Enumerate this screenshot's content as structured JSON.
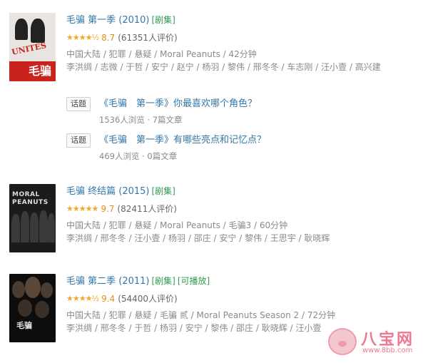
{
  "items": [
    {
      "title": "毛骗 第一季 (2010)",
      "tags": [
        "[剧集]"
      ],
      "stars": "★★★★½",
      "score": "8.7",
      "count": "(61351人评价)",
      "meta1": "中国大陆 / 犯罪 / 悬疑 / Moral Peanuts / 42分钟",
      "meta2": "李洪绸 / 志微 / 于哲 / 安宁 / 赵宁 / 杨羽 / 黎伟 / 邢冬冬 / 车志刚 / 汪小壹 / 高兴建",
      "poster_logo": "毛骗",
      "poster_text": "UNITES"
    },
    {
      "title": "毛骗 终结篇 (2015)",
      "tags": [
        "[剧集]"
      ],
      "stars": "★★★★★",
      "score": "9.7",
      "count": "(82411人评价)",
      "meta1": "中国大陆 / 犯罪 / 悬疑 / Moral Peanuts / 毛骗3 / 60分钟",
      "meta2": "李洪绸 / 邢冬冬 / 汪小壹 / 杨羽 / 邵庄 / 安宁 / 黎伟 / 王思宇 / 耿晓辉",
      "poster_line1": "MORAL",
      "poster_line2": "PEANUTS"
    },
    {
      "title": "毛骗 第二季 (2011)",
      "tags": [
        "[剧集]",
        "[可播放]"
      ],
      "stars": "★★★★½",
      "score": "9.4",
      "count": "(54400人评价)",
      "meta1": "中国大陆 / 犯罪 / 悬疑 / 毛骗 贰 / Moral Peanuts Season 2 / 72分钟",
      "meta2": "李洪绸 / 邢冬冬 / 于哲 / 杨羽 / 安宁 / 黎伟 / 邵庄 / 耿晓辉 / 汪小壹",
      "poster_logo": "毛骗"
    }
  ],
  "topics": [
    {
      "tag": "话题",
      "title": "《毛骗　第一季》你最喜欢哪个角色？",
      "sub": "1536人浏览 · 7篇文章"
    },
    {
      "tag": "话题",
      "title": "《毛骗　第一季》有哪些亮点和记忆点？",
      "sub": "469人浏览 · 0篇文章"
    }
  ],
  "watermark": {
    "brand": "八宝网",
    "url": "www.8bb.com"
  },
  "colors": {
    "link": "#3377aa",
    "tag_green": "#2f9b4f",
    "star": "#f5a623",
    "score": "#e09015",
    "meta": "#8a8a8a"
  }
}
